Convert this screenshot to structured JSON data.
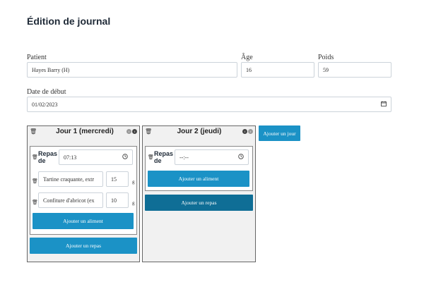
{
  "page": {
    "title": "Édition de journal"
  },
  "form": {
    "patient_label": "Patient",
    "patient_value": "Hayes Barry (H)",
    "age_label": "Âge",
    "age_value": "16",
    "poids_label": "Poids",
    "poids_value": "59",
    "date_label": "Date de début",
    "date_value": "01/02/2023"
  },
  "days": [
    {
      "title": "Jour 1 (mercredi)",
      "meals": [
        {
          "label": "Repas de",
          "time": "07:13",
          "foods": [
            {
              "name": "Tartine craquante, extr",
              "qty": "15",
              "unit": "g"
            },
            {
              "name": "Confiture d'abricot (ex",
              "qty": "10",
              "unit": "g"
            }
          ],
          "add_food_label": "Ajouter un aliment"
        }
      ],
      "add_meal_label": "Ajouter un repas"
    },
    {
      "title": "Jour 2 (jeudi)",
      "meals": [
        {
          "label": "Repas de",
          "time": "--:--",
          "foods": [],
          "add_food_label": "Ajouter un aliment"
        }
      ],
      "add_meal_label": "Ajouter un repas"
    }
  ],
  "add_day_label": "Ajouter un jour",
  "icons": {
    "trash": "trash-icon",
    "clock": "clock-icon",
    "calendar": "calendar-icon",
    "move_left": "move-left-icon",
    "move_right": "move-right-icon"
  },
  "colors": {
    "accent": "#1b92c6",
    "accent_dark": "#0f6e96"
  }
}
